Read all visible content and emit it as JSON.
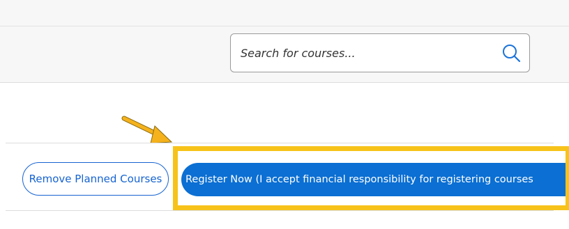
{
  "search": {
    "placeholder": "Search for courses...",
    "icon": "search-icon"
  },
  "annotations": {
    "arrow_color": "#f5b21c",
    "highlight_color": "#f7c31a"
  },
  "actions": {
    "remove_label": "Remove Planned Courses",
    "register_label": "Register Now (I accept financial responsibility for registering courses"
  },
  "colors": {
    "primary": "#0b6fd3",
    "outline": "#1563d1",
    "band_bg": "#f7f7f7"
  }
}
